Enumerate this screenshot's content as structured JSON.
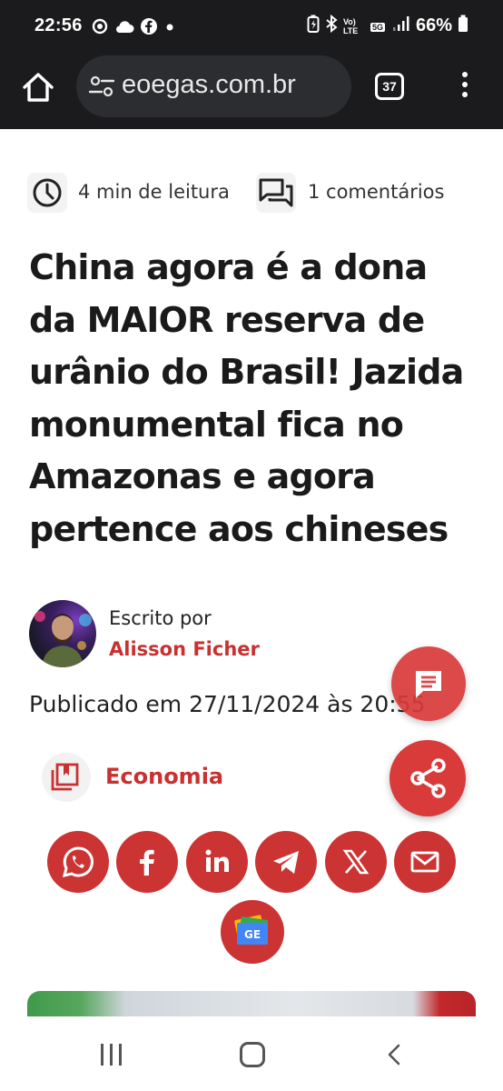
{
  "status_bar": {
    "time": "22:56",
    "left_icons": [
      "screen-record-icon",
      "cloud-icon",
      "facebook-icon",
      "dot-icon"
    ],
    "right_icons": [
      "battery-saver-icon",
      "bluetooth-icon",
      "volte-icon",
      "5g-icon",
      "signal-icon"
    ],
    "volte_label": "Vo) LTE",
    "network_label": "5G",
    "battery": "66%"
  },
  "browser": {
    "url": "eoegas.com.br",
    "tab_count": "37"
  },
  "article": {
    "read_time": "4 min de leitura",
    "comments": "1 comentários",
    "title": "China agora é a dona da MAIOR reserva de urânio do Brasil! Jazida monumental fica no Amazonas e agora pertence aos chineses",
    "author_label": "Escrito por",
    "author_name": "Alisson Ficher",
    "published": "Publicado em 27/11/2024 às 20:55",
    "category": "Economia"
  },
  "share": {
    "buttons": [
      "whatsapp-icon",
      "facebook-icon",
      "linkedin-icon",
      "telegram-icon",
      "x-icon",
      "email-icon"
    ],
    "gnews_label": "GE"
  },
  "colors": {
    "accent": "#d93a3a",
    "status_bar_bg": "#1b1b1d",
    "url_pill_bg": "#2c2d31"
  }
}
